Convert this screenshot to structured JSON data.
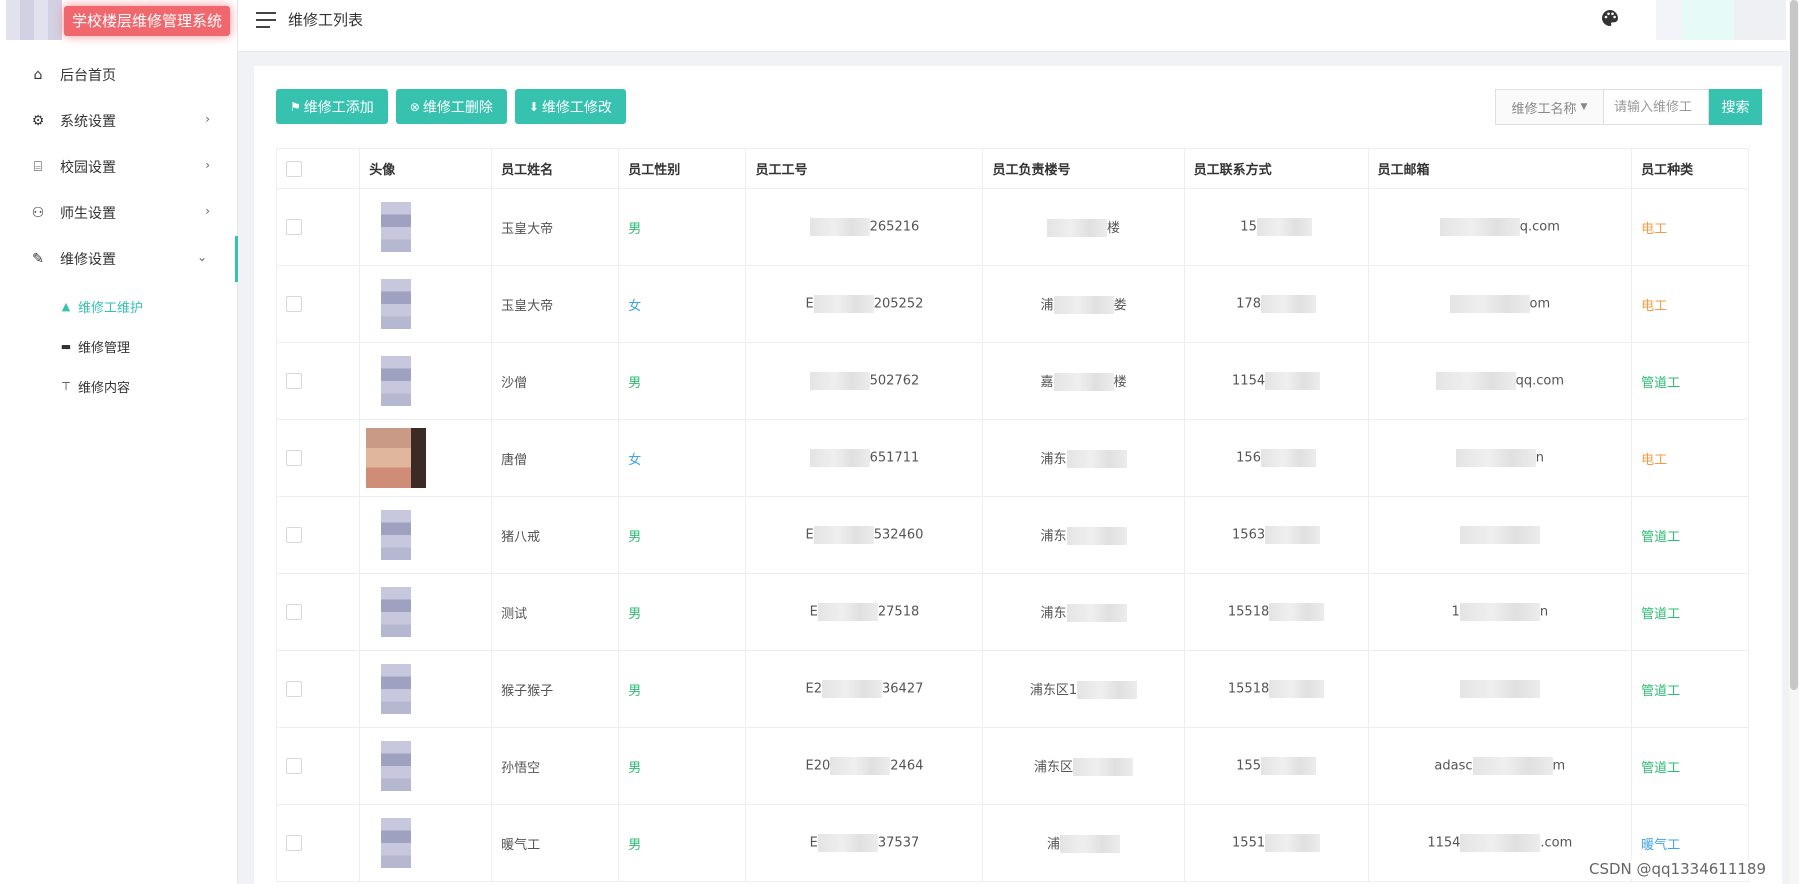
{
  "app": {
    "title": "学校楼层维修管理系统"
  },
  "header": {
    "page_title": "维修工列表",
    "theme_icon": "palette-icon"
  },
  "sidebar": {
    "items": [
      {
        "label": "后台首页",
        "icon": "home-icon",
        "glyph": "⌂",
        "has_arrow": false
      },
      {
        "label": "系统设置",
        "icon": "gear-icon",
        "glyph": "⚙",
        "has_arrow": true
      },
      {
        "label": "校园设置",
        "icon": "bank-icon",
        "glyph": "⌸",
        "has_arrow": true
      },
      {
        "label": "师生设置",
        "icon": "people-icon",
        "glyph": "⚇",
        "has_arrow": true
      },
      {
        "label": "维修设置",
        "icon": "wrench-icon",
        "glyph": "✎",
        "has_arrow": true,
        "expanded": true
      }
    ],
    "sub_items": [
      {
        "label": "维修工维护",
        "icon": "user-icon",
        "glyph": "▲",
        "selected": true
      },
      {
        "label": "维修管理",
        "icon": "car-icon",
        "glyph": "▬",
        "selected": false
      },
      {
        "label": "维修内容",
        "icon": "download-icon",
        "glyph": "⊤",
        "selected": false
      }
    ]
  },
  "toolbar": {
    "add_label": "维修工添加",
    "delete_label": "维修工删除",
    "edit_label": "维修工修改"
  },
  "search": {
    "field_label": "维修工名称",
    "placeholder": "请输入维修工",
    "button_label": "搜索"
  },
  "table": {
    "headers": [
      "头像",
      "员工姓名",
      "员工性别",
      "员工工号",
      "员工负责楼号",
      "员工联系方式",
      "员工邮箱",
      "员工种类"
    ],
    "rows": [
      {
        "name": "玉皇大帝",
        "gender": "男",
        "gender_kind": "male",
        "id_prefix": "",
        "id_suffix": "265216",
        "building_prefix": "",
        "building_suffix": "楼",
        "phone_prefix": "15",
        "email_prefix": "",
        "email_suffix": "q.com",
        "type": "电工",
        "type_kind": "elec",
        "photo": false
      },
      {
        "name": "玉皇大帝",
        "gender": "女",
        "gender_kind": "female",
        "id_prefix": "E",
        "id_suffix": "205252",
        "building_prefix": "浦",
        "building_suffix": "娄",
        "phone_prefix": "178",
        "email_prefix": "",
        "email_suffix": "om",
        "type": "电工",
        "type_kind": "elec",
        "photo": false
      },
      {
        "name": "沙僧",
        "gender": "男",
        "gender_kind": "male",
        "id_prefix": "",
        "id_suffix": "502762",
        "building_prefix": "嘉",
        "building_suffix": "楼",
        "phone_prefix": "1154",
        "email_prefix": "",
        "email_suffix": "qq.com",
        "type": "管道工",
        "type_kind": "pipe",
        "photo": false
      },
      {
        "name": "唐僧",
        "gender": "女",
        "gender_kind": "female",
        "id_prefix": "",
        "id_suffix": "651711",
        "building_prefix": "浦东",
        "building_suffix": "",
        "phone_prefix": "156",
        "email_prefix": "",
        "email_suffix": "n",
        "type": "电工",
        "type_kind": "elec",
        "photo": true
      },
      {
        "name": "猪八戒",
        "gender": "男",
        "gender_kind": "male",
        "id_prefix": "E",
        "id_suffix": "532460",
        "building_prefix": "浦东",
        "building_suffix": "",
        "phone_prefix": "1563",
        "email_prefix": "",
        "email_suffix": "",
        "type": "管道工",
        "type_kind": "pipe",
        "photo": false
      },
      {
        "name": "测试",
        "gender": "男",
        "gender_kind": "male",
        "id_prefix": "E",
        "id_suffix": "27518",
        "building_prefix": "浦东",
        "building_suffix": "",
        "phone_prefix": "15518",
        "email_prefix": "1",
        "email_suffix": "n",
        "type": "管道工",
        "type_kind": "pipe",
        "photo": false
      },
      {
        "name": "猴子猴子",
        "gender": "男",
        "gender_kind": "male",
        "id_prefix": "E2",
        "id_suffix": "36427",
        "building_prefix": "浦东区1",
        "building_suffix": "",
        "phone_prefix": "15518",
        "email_prefix": "",
        "email_suffix": "",
        "type": "管道工",
        "type_kind": "pipe",
        "photo": false
      },
      {
        "name": "孙悟空",
        "gender": "男",
        "gender_kind": "male",
        "id_prefix": "E20",
        "id_suffix": "2464",
        "building_prefix": "浦东区",
        "building_suffix": "",
        "phone_prefix": "155",
        "email_prefix": "adasc",
        "email_suffix": "m",
        "type": "管道工",
        "type_kind": "pipe",
        "photo": false
      },
      {
        "name": "暖气工",
        "gender": "男",
        "gender_kind": "male",
        "id_prefix": "E",
        "id_suffix": "37537",
        "building_prefix": "浦",
        "building_suffix": "",
        "phone_prefix": "1551",
        "email_prefix": "1154",
        "email_suffix": ".com",
        "type": "暖气工",
        "type_kind": "heat",
        "photo": false
      }
    ]
  },
  "watermark": "CSDN @qq1334611189",
  "colors": {
    "accent": "#37c2b0",
    "male": "#2bbd72",
    "female": "#42a3ea",
    "electrician": "#f59b43",
    "pipe": "#2bbd72",
    "heating": "#42a3ea"
  }
}
